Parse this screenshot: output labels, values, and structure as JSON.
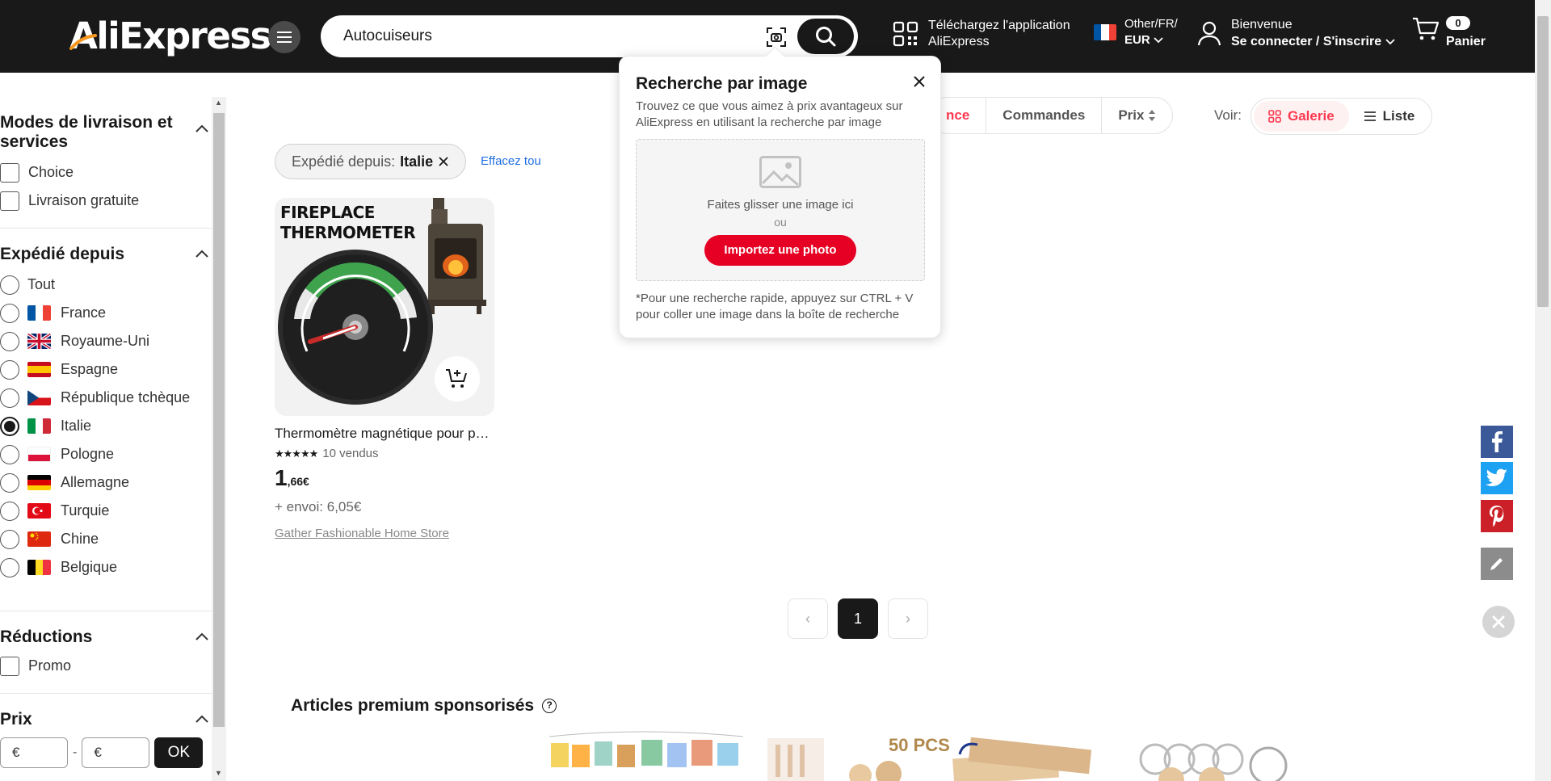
{
  "header": {
    "logo": "AliExpress",
    "search_value": "Autocuiseurs",
    "app_line1": "Téléchargez l'application",
    "app_line2": "AliExpress",
    "locale_line1": "Other/FR/",
    "locale_line2": "EUR",
    "welcome": "Bienvenue",
    "signin": "Se connecter / S'inscrire",
    "cart_count": "0",
    "cart_label": "Panier"
  },
  "filters": {
    "delivery": {
      "title": "Modes de livraison et services",
      "options": [
        "Choice",
        "Livraison gratuite"
      ]
    },
    "shipped_from": {
      "title": "Expédié depuis",
      "options": [
        "Tout",
        "France",
        "Royaume-Uni",
        "Espagne",
        "République tchèque",
        "Italie",
        "Pologne",
        "Allemagne",
        "Turquie",
        "Chine",
        "Belgique"
      ],
      "selected": "Italie"
    },
    "discounts": {
      "title": "Réductions",
      "options": [
        "Promo"
      ]
    },
    "price": {
      "title": "Prix",
      "min_placeholder": "€",
      "max_placeholder": "€",
      "separator": "-",
      "ok_label": "OK"
    }
  },
  "sort": {
    "relevance_partial": "nce",
    "orders": "Commandes",
    "price": "Prix",
    "view_label": "Voir:",
    "gallery": "Galerie",
    "list": "Liste"
  },
  "active_filter": {
    "label": "Expédié depuis:",
    "value": "Italie",
    "clear_all": "Effacez tou"
  },
  "product": {
    "image_text_line1": "FIREPLACE",
    "image_text_line2": "THERMOMETER",
    "title": "Thermomètre magnétique pour poêle à bois",
    "rating": 5,
    "sold": "10 vendus",
    "price_int": "1",
    "price_dec": ",66€",
    "shipping": "+ envoi: 6,05€",
    "store": "Gather Fashionable Home Store"
  },
  "pagination": {
    "prev": "‹",
    "current": "1",
    "next": "›"
  },
  "sponsored": {
    "title": "Articles premium sponsorisés",
    "help": "?",
    "thumb_text": "50 PCS"
  },
  "image_search_popup": {
    "title": "Recherche par image",
    "description": "Trouvez ce que vous aimez à prix avantageux sur AliExpress en utilisant la recherche par image",
    "drag_text": "Faites glisser une image ici",
    "or_text": "ou",
    "upload_button": "Importez une photo",
    "note": "*Pour une recherche rapide, appuyez sur CTRL + V pour coller une image dans la boîte de recherche"
  },
  "colors": {
    "header_bg": "#191919",
    "accent_red": "#fd384f",
    "button_red": "#e60023",
    "link_blue": "#1f6fe5"
  }
}
